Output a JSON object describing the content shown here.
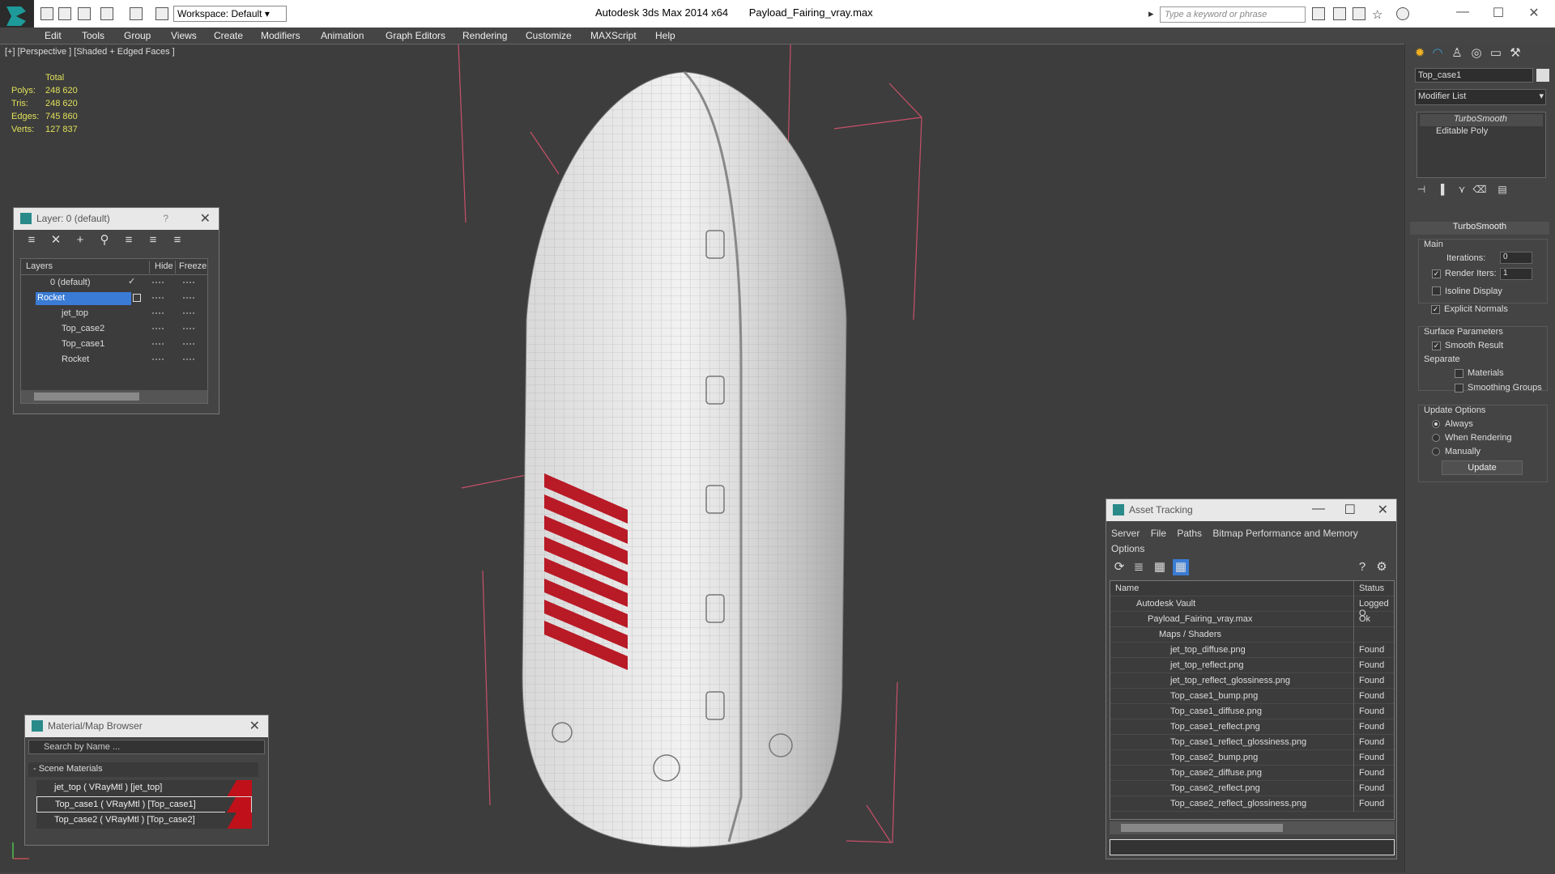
{
  "titlebar": {
    "app_title": "Autodesk 3ds Max  2014 x64",
    "file_name": "Payload_Fairing_vray.max",
    "workspace": "Workspace: Default",
    "search_placeholder": "Type a keyword or phrase"
  },
  "menu": [
    "Edit",
    "Tools",
    "Group",
    "Views",
    "Create",
    "Modifiers",
    "Animation",
    "Graph Editors",
    "Rendering",
    "Customize",
    "MAXScript",
    "Help"
  ],
  "viewport": {
    "label": "[+] [Perspective ] [Shaded + Edged Faces ]",
    "stats": {
      "header": "Total",
      "rows": [
        {
          "k": "Polys:",
          "v": "248 620"
        },
        {
          "k": "Tris:",
          "v": "248 620"
        },
        {
          "k": "Edges:",
          "v": "745 860"
        },
        {
          "k": "Verts:",
          "v": "127 837"
        }
      ]
    }
  },
  "layers": {
    "title": "Layer: 0 (default)",
    "help": "?",
    "columns": [
      "Layers",
      "Hide",
      "Freeze"
    ],
    "rows": [
      {
        "name": "0 (default)",
        "indent": 0,
        "active": true
      },
      {
        "name": "Rocket",
        "indent": 0,
        "selected": true
      },
      {
        "name": "jet_top",
        "indent": 1
      },
      {
        "name": "Top_case2",
        "indent": 1
      },
      {
        "name": "Top_case1",
        "indent": 1
      },
      {
        "name": "Rocket",
        "indent": 1
      }
    ]
  },
  "material_browser": {
    "title": "Material/Map Browser",
    "search_placeholder": "Search by Name ...",
    "section": "- Scene Materials",
    "items": [
      "jet_top  ( VRayMtl ) [jet_top]",
      "Top_case1  ( VRayMtl ) [Top_case1]",
      "Top_case2  ( VRayMtl ) [Top_case2]"
    ]
  },
  "asset_tracking": {
    "title": "Asset Tracking",
    "menu": [
      "Server",
      "File",
      "Paths",
      "Bitmap Performance and Memory",
      "Options"
    ],
    "columns": [
      "Name",
      "Status"
    ],
    "rows": [
      {
        "name": "Autodesk Vault",
        "status": "Logged O",
        "level": 1
      },
      {
        "name": "Payload_Fairing_vray.max",
        "status": "Ok",
        "level": 2
      },
      {
        "name": "Maps / Shaders",
        "status": "",
        "level": 3
      },
      {
        "name": "jet_top_diffuse.png",
        "status": "Found",
        "level": 4
      },
      {
        "name": "jet_top_reflect.png",
        "status": "Found",
        "level": 4
      },
      {
        "name": "jet_top_reflect_glossiness.png",
        "status": "Found",
        "level": 4
      },
      {
        "name": "Top_case1_bump.png",
        "status": "Found",
        "level": 4
      },
      {
        "name": "Top_case1_diffuse.png",
        "status": "Found",
        "level": 4
      },
      {
        "name": "Top_case1_reflect.png",
        "status": "Found",
        "level": 4
      },
      {
        "name": "Top_case1_reflect_glossiness.png",
        "status": "Found",
        "level": 4
      },
      {
        "name": "Top_case2_bump.png",
        "status": "Found",
        "level": 4
      },
      {
        "name": "Top_case2_diffuse.png",
        "status": "Found",
        "level": 4
      },
      {
        "name": "Top_case2_reflect.png",
        "status": "Found",
        "level": 4
      },
      {
        "name": "Top_case2_reflect_glossiness.png",
        "status": "Found",
        "level": 4
      }
    ]
  },
  "command_panel": {
    "object_name": "Top_case1",
    "modifier_list": "Modifier List",
    "stack": [
      "TurboSmooth",
      "Editable Poly"
    ],
    "rollout_title": "TurboSmooth",
    "main_label": "Main",
    "iterations_label": "Iterations:",
    "iterations_value": "0",
    "render_iters_label": "Render Iters:",
    "render_iters_value": "1",
    "isoline_label": "Isoline Display",
    "explicit_normals_label": "Explicit Normals",
    "surface_label": "Surface Parameters",
    "smooth_result_label": "Smooth Result",
    "separate_label": "Separate",
    "materials_label": "Materials",
    "smoothing_groups_label": "Smoothing Groups",
    "update_options_label": "Update Options",
    "always_label": "Always",
    "when_rendering_label": "When Rendering",
    "manually_label": "Manually",
    "update_button": "Update"
  }
}
